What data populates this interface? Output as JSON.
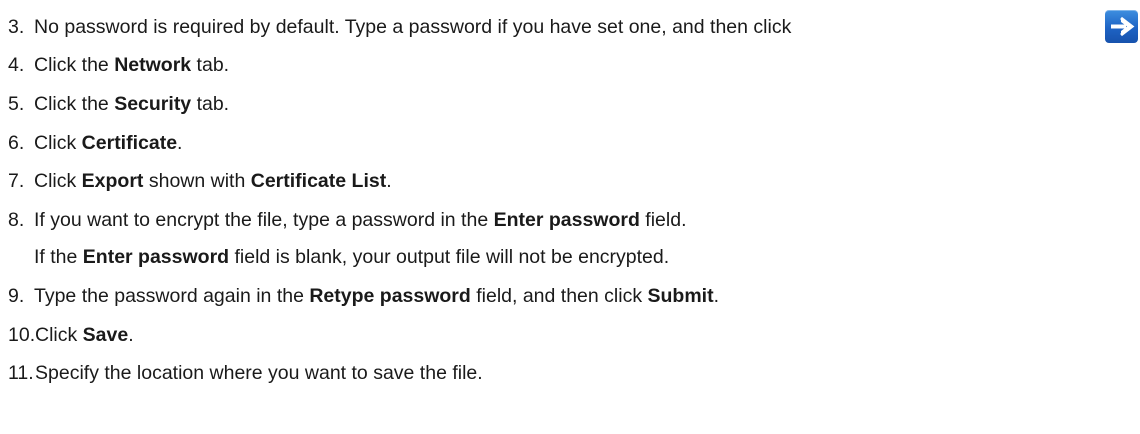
{
  "steps": [
    {
      "number": "3.",
      "parts": [
        "No password is required by default. Type a password if you have set one, and then click"
      ],
      "icon": "arrow-right-icon"
    },
    {
      "number": "4.",
      "parts": [
        "Click the ",
        "Network",
        " tab."
      ]
    },
    {
      "number": "5.",
      "parts": [
        "Click the ",
        "Security",
        " tab."
      ]
    },
    {
      "number": "6.",
      "parts": [
        "Click ",
        "Certificate",
        "."
      ]
    },
    {
      "number": "7.",
      "parts": [
        "Click ",
        "Export",
        " shown with ",
        "Certificate List",
        "."
      ]
    },
    {
      "number": "8.",
      "parts": [
        "If you want to encrypt the file, type a password in the ",
        "Enter password",
        " field."
      ],
      "note_parts": [
        "If the ",
        "Enter password",
        " field is blank, your output file will not be encrypted."
      ]
    },
    {
      "number": "9.",
      "parts": [
        "Type the password again in the ",
        "Retype password",
        " field, and then click ",
        "Submit",
        "."
      ]
    },
    {
      "number": "10.",
      "parts": [
        "Click ",
        "Save",
        "."
      ]
    },
    {
      "number": "11.",
      "parts": [
        "Specify the location where you want to save the file."
      ]
    }
  ],
  "colors": {
    "text": "#1a1a1a",
    "arrow_button": "#1e63c4"
  }
}
